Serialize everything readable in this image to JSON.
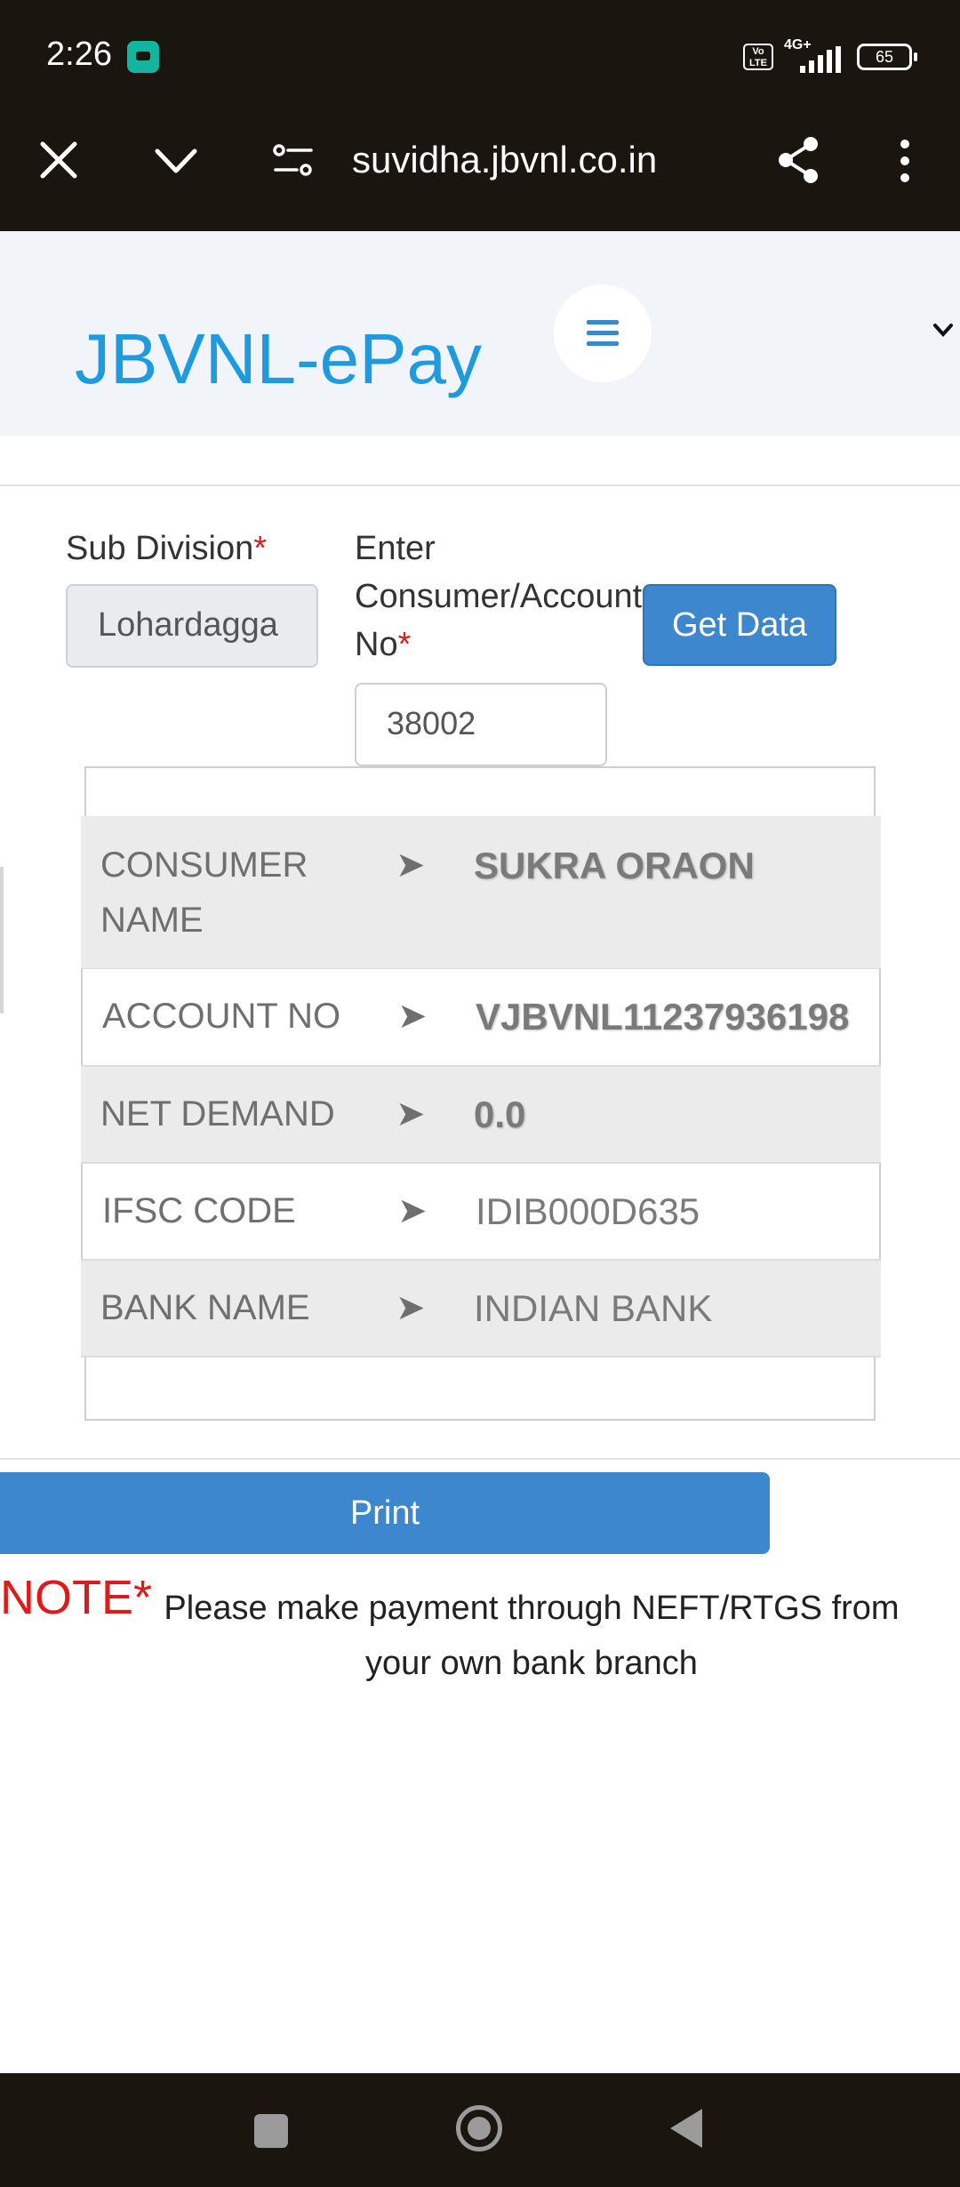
{
  "status_bar": {
    "time": "2:26",
    "volte": "Vo LTE",
    "network": "4G+",
    "battery": "65"
  },
  "browser": {
    "url": "suvidha.jbvnl.co.in"
  },
  "site": {
    "brand": "JBVNL-ePay"
  },
  "form": {
    "sub_division_label": "Sub Division",
    "required_mark": "*",
    "sub_division_value": "Lohardagga",
    "consumer_label_line1": "Enter",
    "consumer_label_line2": "Consumer/Account",
    "consumer_label_line3": "No",
    "consumer_value": "38002",
    "get_data_label": "Get Data"
  },
  "details": {
    "arrow": "➤",
    "rows": [
      {
        "label_line1": "CONSUMER",
        "label_line2": "NAME",
        "value": "SUKRA ORAON"
      },
      {
        "label": "ACCOUNT NO",
        "value": "VJBVNL11237936198"
      },
      {
        "label": "NET DEMAND",
        "value": "0.0"
      },
      {
        "label": "IFSC CODE",
        "value": "IDIB000D635"
      },
      {
        "label": "BANK NAME",
        "value": "INDIAN BANK"
      }
    ]
  },
  "print_label": "Print",
  "note": {
    "tag": "NOTE*",
    "text": "Please make payment through NEFT/RTGS from your own bank branch"
  }
}
